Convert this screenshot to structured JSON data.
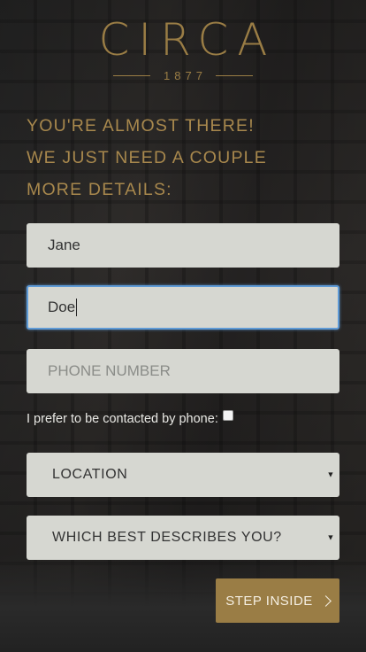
{
  "brand": {
    "name": "CIRCA",
    "year": "1877",
    "color": "#9a7d45"
  },
  "heading": {
    "lines": [
      "YOU'RE ALMOST THERE!",
      "WE JUST NEED A COUPLE",
      "MORE DETAILS:"
    ]
  },
  "form": {
    "first_name": {
      "value": "Jane",
      "placeholder": ""
    },
    "last_name": {
      "value": "Doe",
      "placeholder": "",
      "focused": true
    },
    "phone": {
      "value": "",
      "placeholder": "PHONE NUMBER"
    },
    "contact_by_phone": {
      "label": "I prefer to be contacted by phone:",
      "checked": false
    },
    "location": {
      "selected": "LOCATION"
    },
    "describes_you": {
      "selected": "WHICH BEST DESCRIBES YOU?"
    },
    "submit_label": "STEP INSIDE"
  },
  "icons": {
    "select_arrow": "chevron-down-icon",
    "submit_arrow": "chevron-right-icon"
  },
  "colors": {
    "accent": "#9a7d45",
    "field_bg": "#d6d7d1",
    "focus_ring": "#5e9ad6"
  }
}
